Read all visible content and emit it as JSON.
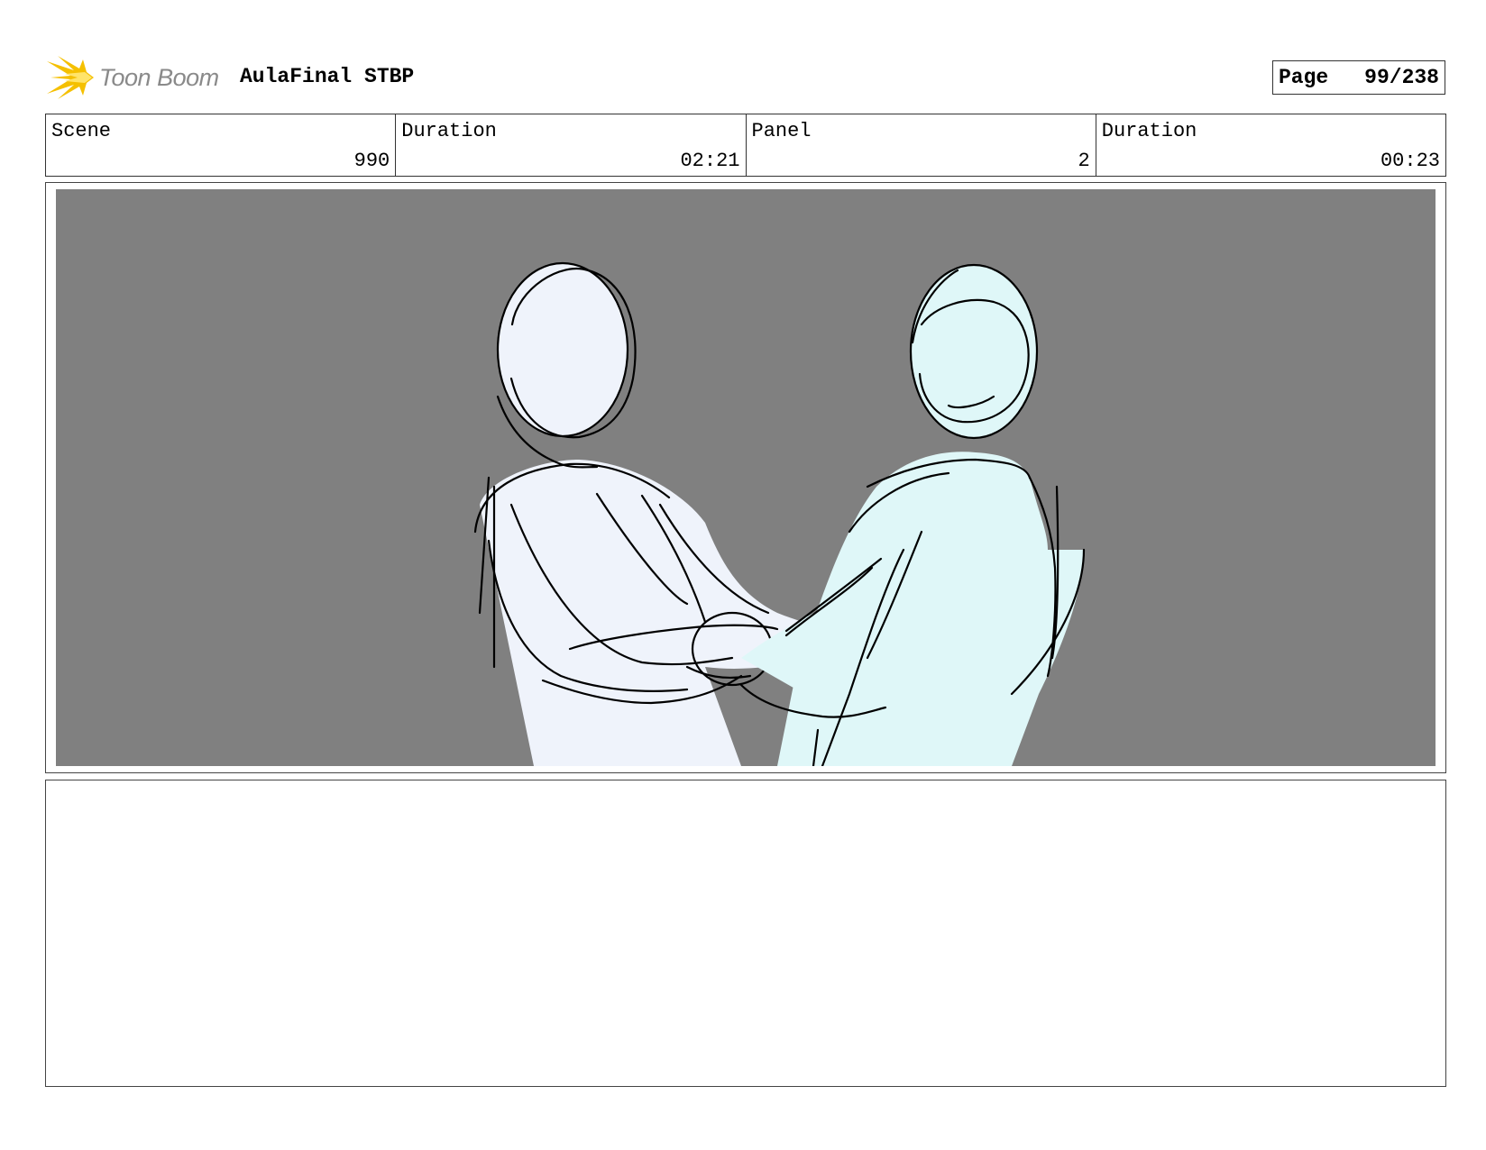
{
  "header": {
    "logo_text": "Toon Boom",
    "project_title": "AulaFinal STBP",
    "page_label": "Page",
    "page_value": "99/238"
  },
  "info": {
    "scene_label": "Scene",
    "scene_value": "990",
    "scene_duration_label": "Duration",
    "scene_duration_value": "02:21",
    "panel_label": "Panel",
    "panel_value": "2",
    "panel_duration_label": "Duration",
    "panel_duration_value": "00:23"
  },
  "colors": {
    "panel_background": "#808080",
    "left_figure_fill": "#eff3fb",
    "right_figure_fill": "#dff7f8",
    "logo_flame": "#f5c000"
  },
  "icons": {
    "logo": "toon-boom-flame-icon"
  }
}
